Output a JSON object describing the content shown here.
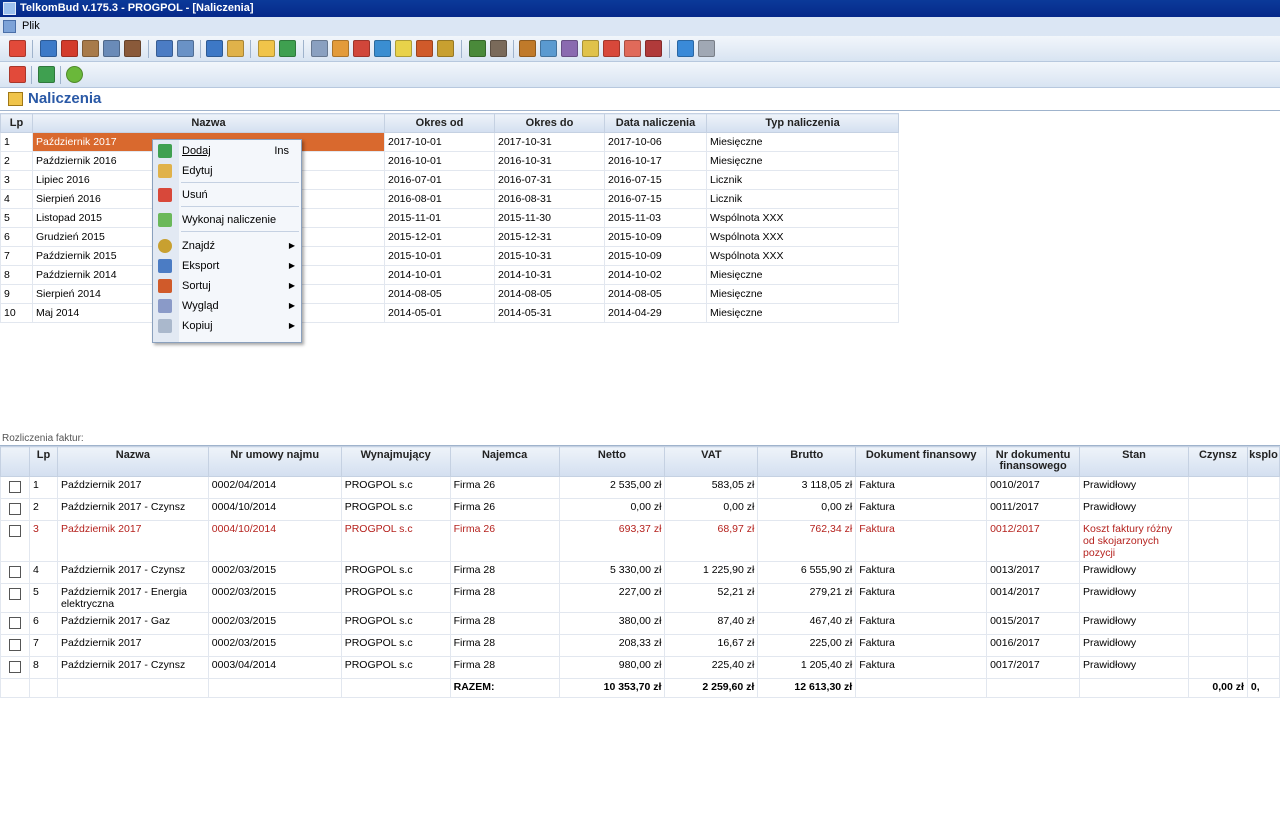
{
  "window": {
    "title": "TelkomBud v.175.3 - PROGPOL - [Naliczenia]"
  },
  "menu": {
    "file": "Plik"
  },
  "page": {
    "title": "Naliczenia"
  },
  "upper_table": {
    "headers": {
      "lp": "Lp",
      "name": "Nazwa",
      "from": "Okres od",
      "to": "Okres do",
      "date": "Data naliczenia",
      "type": "Typ naliczenia"
    },
    "rows": [
      {
        "lp": "1",
        "name": "Październik 2017",
        "from": "2017-10-01",
        "to": "2017-10-31",
        "date": "2017-10-06",
        "type": "Miesięczne"
      },
      {
        "lp": "2",
        "name": "Październik 2016",
        "from": "2016-10-01",
        "to": "2016-10-31",
        "date": "2016-10-17",
        "type": "Miesięczne"
      },
      {
        "lp": "3",
        "name": "Lipiec 2016",
        "from": "2016-07-01",
        "to": "2016-07-31",
        "date": "2016-07-15",
        "type": "Licznik"
      },
      {
        "lp": "4",
        "name": "Sierpień 2016",
        "from": "2016-08-01",
        "to": "2016-08-31",
        "date": "2016-07-15",
        "type": "Licznik"
      },
      {
        "lp": "5",
        "name": "Listopad 2015",
        "from": "2015-11-01",
        "to": "2015-11-30",
        "date": "2015-11-03",
        "type": "Wspólnota XXX"
      },
      {
        "lp": "6",
        "name": "Grudzień 2015",
        "from": "2015-12-01",
        "to": "2015-12-31",
        "date": "2015-10-09",
        "type": "Wspólnota XXX"
      },
      {
        "lp": "7",
        "name": "Październik 2015",
        "from": "2015-10-01",
        "to": "2015-10-31",
        "date": "2015-10-09",
        "type": "Wspólnota XXX"
      },
      {
        "lp": "8",
        "name": "Październik 2014",
        "from": "2014-10-01",
        "to": "2014-10-31",
        "date": "2014-10-02",
        "type": "Miesięczne"
      },
      {
        "lp": "9",
        "name": "Sierpień 2014",
        "from": "2014-08-05",
        "to": "2014-08-05",
        "date": "2014-08-05",
        "type": "Miesięczne"
      },
      {
        "lp": "10",
        "name": "Maj 2014",
        "from": "2014-05-01",
        "to": "2014-05-31",
        "date": "2014-04-29",
        "type": "Miesięczne"
      }
    ]
  },
  "context_menu": {
    "add": "Dodaj",
    "add_shortcut": "Ins",
    "edit": "Edytuj",
    "delete": "Usuń",
    "run": "Wykonaj naliczenie",
    "find": "Znajdź",
    "export": "Eksport",
    "sort": "Sortuj",
    "view": "Wygląd",
    "copy": "Kopiuj"
  },
  "lower": {
    "label": "Rozliczenia faktur:",
    "headers": {
      "lp": "Lp",
      "name": "Nazwa",
      "contract": "Nr umowy najmu",
      "landlord": "Wynajmujący",
      "tenant": "Najemca",
      "net": "Netto",
      "vat": "VAT",
      "gross": "Brutto",
      "doc": "Dokument finansowy",
      "docnr": "Nr dokumentu finansowego",
      "state": "Stan",
      "rent": "Czynsz",
      "extra": "ksplo"
    },
    "rows": [
      {
        "lp": "1",
        "name": "Październik 2017",
        "contract": "0002/04/2014",
        "landlord": "PROGPOL s.c",
        "tenant": "Firma 26",
        "net": "2 535,00 zł",
        "vat": "583,05 zł",
        "gross": "3 118,05 zł",
        "doc": "Faktura",
        "docnr": "0010/2017",
        "state": "Prawidłowy"
      },
      {
        "lp": "2",
        "name": "Październik 2017 - Czynsz",
        "contract": "0004/10/2014",
        "landlord": "PROGPOL s.c",
        "tenant": "Firma 26",
        "net": "0,00 zł",
        "vat": "0,00 zł",
        "gross": "0,00 zł",
        "doc": "Faktura",
        "docnr": "0011/2017",
        "state": "Prawidłowy"
      },
      {
        "lp": "3",
        "name": "Październik 2017",
        "contract": "0004/10/2014",
        "landlord": "PROGPOL s.c",
        "tenant": "Firma 26",
        "net": "693,37 zł",
        "vat": "68,97 zł",
        "gross": "762,34 zł",
        "doc": "Faktura",
        "docnr": "0012/2017",
        "state": "Koszt faktury różny od skojarzonych pozycji"
      },
      {
        "lp": "4",
        "name": "Październik 2017 - Czynsz",
        "contract": "0002/03/2015",
        "landlord": "PROGPOL s.c",
        "tenant": "Firma 28",
        "net": "5 330,00 zł",
        "vat": "1 225,90 zł",
        "gross": "6 555,90 zł",
        "doc": "Faktura",
        "docnr": "0013/2017",
        "state": "Prawidłowy"
      },
      {
        "lp": "5",
        "name": "Październik 2017 - Energia elektryczna",
        "contract": "0002/03/2015",
        "landlord": "PROGPOL s.c",
        "tenant": "Firma 28",
        "net": "227,00 zł",
        "vat": "52,21 zł",
        "gross": "279,21 zł",
        "doc": "Faktura",
        "docnr": "0014/2017",
        "state": "Prawidłowy"
      },
      {
        "lp": "6",
        "name": "Październik 2017 - Gaz",
        "contract": "0002/03/2015",
        "landlord": "PROGPOL s.c",
        "tenant": "Firma 28",
        "net": "380,00 zł",
        "vat": "87,40 zł",
        "gross": "467,40 zł",
        "doc": "Faktura",
        "docnr": "0015/2017",
        "state": "Prawidłowy"
      },
      {
        "lp": "7",
        "name": "Październik 2017",
        "contract": "0002/03/2015",
        "landlord": "PROGPOL s.c",
        "tenant": "Firma 28",
        "net": "208,33 zł",
        "vat": "16,67 zł",
        "gross": "225,00 zł",
        "doc": "Faktura",
        "docnr": "0016/2017",
        "state": "Prawidłowy"
      },
      {
        "lp": "8",
        "name": "Październik 2017 - Czynsz",
        "contract": "0003/04/2014",
        "landlord": "PROGPOL s.c",
        "tenant": "Firma 28",
        "net": "980,00 zł",
        "vat": "225,40 zł",
        "gross": "1 205,40 zł",
        "doc": "Faktura",
        "docnr": "0017/2017",
        "state": "Prawidłowy"
      }
    ],
    "totals": {
      "label": "RAZEM:",
      "net": "10 353,70 zł",
      "vat": "2 259,60 zł",
      "gross": "12 613,30 zł",
      "rent": "0,00 zł",
      "extra": "0,"
    }
  },
  "colors": {
    "selection": "#d9692e",
    "title_bar": "#0b3a99",
    "error_row": "#b5221e",
    "header_title": "#2a59a6"
  }
}
